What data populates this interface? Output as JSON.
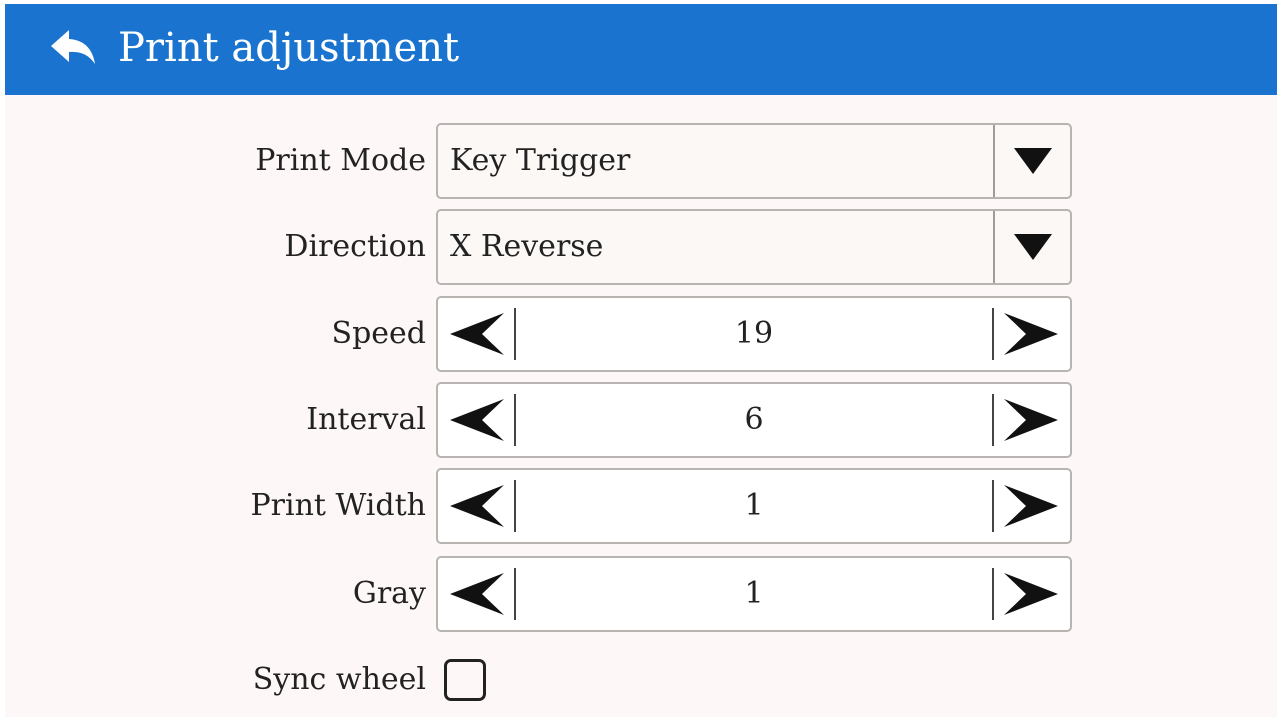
{
  "header": {
    "title": "Print adjustment",
    "back_icon": "back-arrow-icon",
    "background": "#1a74cf"
  },
  "form": {
    "print_mode": {
      "label": "Print Mode",
      "value": "Key Trigger",
      "icon": "triangle-down-icon"
    },
    "direction": {
      "label": "Direction",
      "value": "X Reverse",
      "icon": "triangle-down-icon"
    },
    "speed": {
      "label": "Speed",
      "value": "19"
    },
    "interval": {
      "label": "Interval",
      "value": "6"
    },
    "print_width": {
      "label": "Print Width",
      "value": "1"
    },
    "gray": {
      "label": "Gray",
      "value": "1"
    },
    "sync_wheel": {
      "label": "Sync wheel",
      "checked": false
    }
  }
}
